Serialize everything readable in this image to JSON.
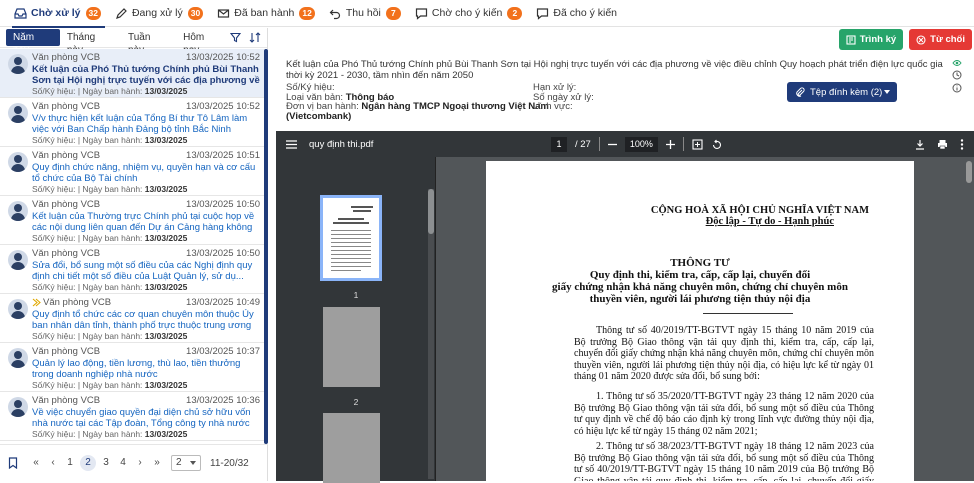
{
  "tabs": [
    {
      "label": "Chờ xử lý",
      "count": "32",
      "icon": "inbox-icon",
      "active": true
    },
    {
      "label": "Đang xử lý",
      "count": "30",
      "icon": "pen-icon"
    },
    {
      "label": "Đã ban hành",
      "count": "12",
      "icon": "mail-icon"
    },
    {
      "label": "Thu hồi",
      "count": "7",
      "icon": "undo-icon"
    },
    {
      "label": "Chờ cho ý kiến",
      "count": "2",
      "icon": "comment-icon"
    },
    {
      "label": "Đã cho ý kiến",
      "count": "",
      "icon": "comment-check-icon"
    }
  ],
  "filters": [
    "Năm nay",
    "Tháng này",
    "Tuần này",
    "Hôm nay"
  ],
  "items": [
    {
      "sender": "Văn phòng VCB",
      "time": "13/03/2025 10:52",
      "title": "Kết luận của Phó Thủ tướng Chính phủ Bùi Thanh Sơn tại Hội nghị trực tuyến với các địa phương về việ...",
      "meta_label": "Số/Ký hiệu: | Ngày ban hành: ",
      "date": "13/03/2025"
    },
    {
      "sender": "Văn phòng VCB",
      "time": "13/03/2025 10:52",
      "title": "V/v thực hiện kết luận của Tổng Bí thư Tô Lâm làm việc với Ban Chấp hành Đảng bộ tỉnh Bắc Ninh",
      "meta_label": "Số/Ký hiệu: | Ngày ban hành: ",
      "date": "13/03/2025"
    },
    {
      "sender": "Văn phòng VCB",
      "time": "13/03/2025 10:51",
      "title": "Quy định chức năng, nhiệm vụ, quyền hạn và cơ cấu tổ chức của Bộ Tài chính",
      "meta_label": "Số/Ký hiệu: | Ngày ban hành: ",
      "date": "13/03/2025"
    },
    {
      "sender": "Văn phòng VCB",
      "time": "13/03/2025 10:50",
      "title": "Kết luận của Thường trực Chính phủ tại cuộc họp về các nội dung liên quan đến Dự án Cảng hàng không ...",
      "meta_label": "Số/Ký hiệu: | Ngày ban hành: ",
      "date": "13/03/2025"
    },
    {
      "sender": "Văn phòng VCB",
      "time": "13/03/2025 10:50",
      "title": "Sửa đổi, bổ sung một số điều của các Nghị định quy định chi tiết một số điều của Luật Quản lý, sử dụ...",
      "meta_label": "Số/Ký hiệu: | Ngày ban hành: ",
      "date": "13/03/2025"
    },
    {
      "sender": "Văn phòng VCB",
      "time": "13/03/2025 10:49",
      "title": "Quy định tổ chức các cơ quan chuyên môn thuộc Ủy ban nhân dân tỉnh, thành phố trực thuộc trung ương ...",
      "meta_label": "Số/Ký hiệu: | Ngày ban hành: ",
      "date": "13/03/2025",
      "forwarded": true
    },
    {
      "sender": "Văn phòng VCB",
      "time": "13/03/2025 10:37",
      "title": "Quản lý lao động, tiền lương, thù lao, tiền thưởng trong doanh nghiệp nhà nước",
      "meta_label": "Số/Ký hiệu: | Ngày ban hành: ",
      "date": "13/03/2025"
    },
    {
      "sender": "Văn phòng VCB",
      "time": "13/03/2025 10:36",
      "title": "Về việc chuyển giao quyền đại diện chủ sở hữu vốn nhà nước tại các Tập đoàn, Tổng công ty nhà nước l...",
      "meta_label": "Số/Ký hiệu: | Ngày ban hành: ",
      "date": "13/03/2025"
    }
  ],
  "pager": {
    "pages": [
      "1",
      "2",
      "3",
      "4"
    ],
    "current": "2",
    "page_size": "2",
    "range": "11-20/32"
  },
  "actions": {
    "submit": "Trình ký",
    "reject": "Từ chối"
  },
  "doc": {
    "title": "Kết luận của Phó Thủ tướng Chính phủ Bùi Thanh Sơn tại Hội nghị trực tuyến với các địa phương về việc điều chỉnh Quy hoạch phát triển điện lực quốc gia thời kỳ 2021 - 2030, tầm nhìn đến năm 2050",
    "so_ky_hieu_label": "Số/Ký hiệu:",
    "loai_vb_label": "Loại văn bản:",
    "loai_vb": "Thông báo",
    "don_vi_label": "Đơn vị ban hành:",
    "don_vi": "Ngân hàng TMCP Ngoại thương Việt Nam",
    "don_vi2": "(Vietcombank)",
    "han_xu_ly_label": "Hạn xử lý:",
    "so_ngay_label": "Số ngày xử lý:",
    "linh_vuc_label": "Lĩnh vực:",
    "attach": "Tệp đính kèm (2)"
  },
  "pdf": {
    "filename": "quy định thi.pdf",
    "page": "1",
    "total": "/ 27",
    "zoom": "100%",
    "thumb_labels": [
      "1",
      "2"
    ],
    "header1": "CỘNG HOÀ XÃ HỘI CHỦ NGHĨA VIỆT NAM",
    "header2": "Độc lập - Tự do - Hạnh phúc",
    "t1": "THÔNG TƯ",
    "t2": "Quy định thi, kiểm tra, cấp, cấp lại, chuyển đổi",
    "t3": "giấy chứng nhận khả năng chuyên môn, chứng chỉ chuyên môn",
    "t4": "thuyền viên, người lái phương tiện thủy nội địa",
    "p1": "Thông tư số 40/2019/TT-BGTVT ngày 15 tháng 10 năm 2019 của Bộ trưởng Bộ Giao thông vận tải quy định thi, kiểm tra, cấp, cấp lại, chuyển đổi giấy chứng nhận khả năng chuyên môn, chứng chỉ chuyên môn thuyền viên, người lái phương tiện thủy nội địa, có hiệu lực kể từ ngày 01 tháng 01 năm 2020 được sửa đổi, bổ sung bởi:",
    "p2": "1. Thông tư số 35/2020/TT-BGTVT ngày 23 tháng 12 năm 2020 của Bộ trưởng Bộ Giao thông vận tải sửa đổi, bổ sung một số điều của Thông tư quy định về chế độ báo cáo định kỳ trong lĩnh vực đường thủy nội địa, có hiệu lực kể từ ngày 15 tháng 02 năm 2021;",
    "p3": "2. Thông tư số 38/2023/TT-BGTVT ngày 18 tháng 12 năm 2023 của Bộ trưởng Bộ Giao thông vận tải sửa đổi, bổ sung một số điều của Thông tư số 40/2019/TT-BGTVT ngày 15 tháng 10 năm 2019 của Bộ trưởng Bộ Giao thông vận tải quy định thi, kiểm tra, cấp, cấp lại, chuyển đổi giấy chứng nhận"
  },
  "colors": {
    "primary": "#1f3b7a",
    "badge": "#f2711c",
    "green": "#27a46a",
    "red": "#e53935",
    "link": "#1565c0"
  }
}
